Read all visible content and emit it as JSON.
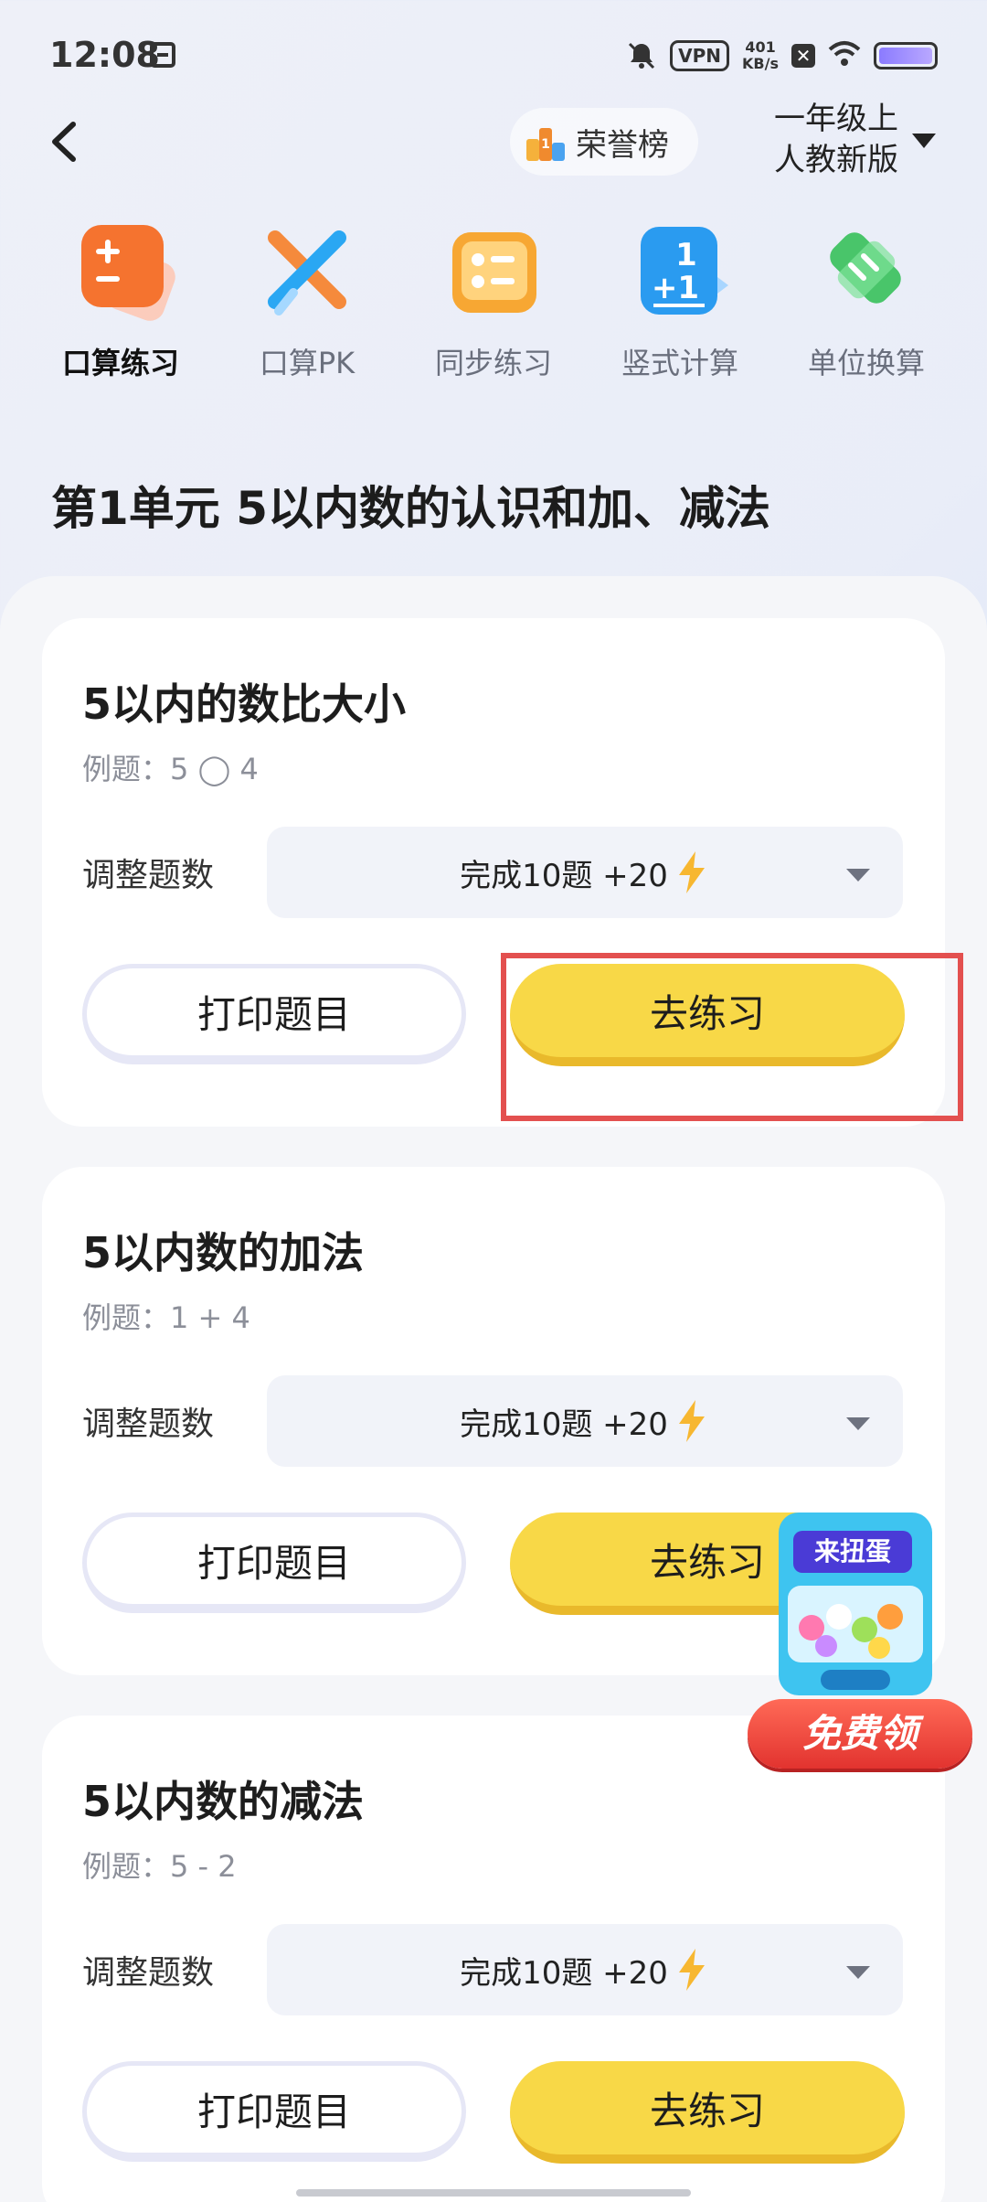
{
  "status": {
    "time": "12:08",
    "vpn": "VPN",
    "speed_value": "401",
    "speed_unit": "KB/s",
    "x_glyph": "✕"
  },
  "header": {
    "honor_label": "荣誉榜",
    "grade": "一年级上",
    "edition": "人教新版"
  },
  "tabs": [
    {
      "label": "口算练习",
      "icon": "plus-minus-icon",
      "color": "#f5732f"
    },
    {
      "label": "口算PK",
      "icon": "crossed-swords-icon",
      "color": "#1da0f0"
    },
    {
      "label": "同步练习",
      "icon": "book-icon",
      "color": "#f7a733"
    },
    {
      "label": "竖式计算",
      "icon": "vertical-calc-icon",
      "color": "#2a9bf0"
    },
    {
      "label": "单位换算",
      "icon": "ruler-pencil-icon",
      "color": "#49c56a"
    }
  ],
  "unit_title": "第1单元 5以内数的认识和加、减法",
  "cards": [
    {
      "title": "5以内的数比大小",
      "example": "例题：5 ◯ 4",
      "adjust_label": "调整题数",
      "count_text": "完成10题 +20",
      "print_label": "打印题目",
      "practice_label": "去练习"
    },
    {
      "title": "5以内数的加法",
      "example": "例题：1 + 4",
      "adjust_label": "调整题数",
      "count_text": "完成10题 +20",
      "print_label": "打印题目",
      "practice_label": "去练习"
    },
    {
      "title": "5以内数的减法",
      "example": "例题：5 - 2",
      "adjust_label": "调整题数",
      "count_text": "完成10题 +20",
      "print_label": "打印题目",
      "practice_label": "去练习"
    }
  ],
  "gacha": {
    "sign": "来扭蛋",
    "button": "免费领"
  },
  "colors": {
    "accent_yellow": "#f8d847",
    "highlight_red": "#e3504f"
  }
}
